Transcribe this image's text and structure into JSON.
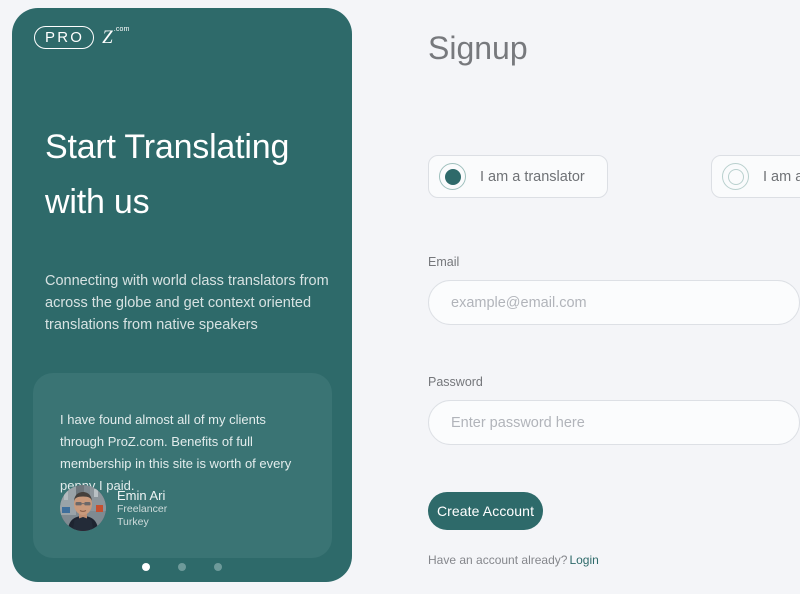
{
  "theme": {
    "accent_teal": "#2e6a6a",
    "card_teal": "#3a7474",
    "page_background": "#f4f5f8",
    "label_gray": "#75777b"
  },
  "promo": {
    "logo": {
      "pro_text": "PRO",
      "z_text": "Z",
      "dotcom_text": ".com"
    },
    "heading": "Start Translating with us",
    "subheading": "Connecting with world class translators from across the globe and get context oriented translations from native speakers",
    "testimonial": {
      "quote": "I have found almost all of my clients through ProZ.com. Benefits of full membership in this site is worth of every penny I paid.",
      "author_name": "Emin Ari",
      "author_role": "Freelancer",
      "author_country": "Turkey"
    },
    "carousel": {
      "dot_count": 3,
      "active_index": 0
    }
  },
  "signup": {
    "title": "Signup",
    "role_options": [
      {
        "label": "I am a translator",
        "selected": true
      },
      {
        "label": "I am a client",
        "selected": false
      }
    ],
    "fields": {
      "email": {
        "label": "Email",
        "placeholder": "example@email.com",
        "value": ""
      },
      "password": {
        "label": "Password",
        "placeholder": "Enter password here",
        "value": ""
      }
    },
    "submit_label": "Create Account",
    "login_prompt": "Have an account already?",
    "login_link_label": "Login"
  }
}
